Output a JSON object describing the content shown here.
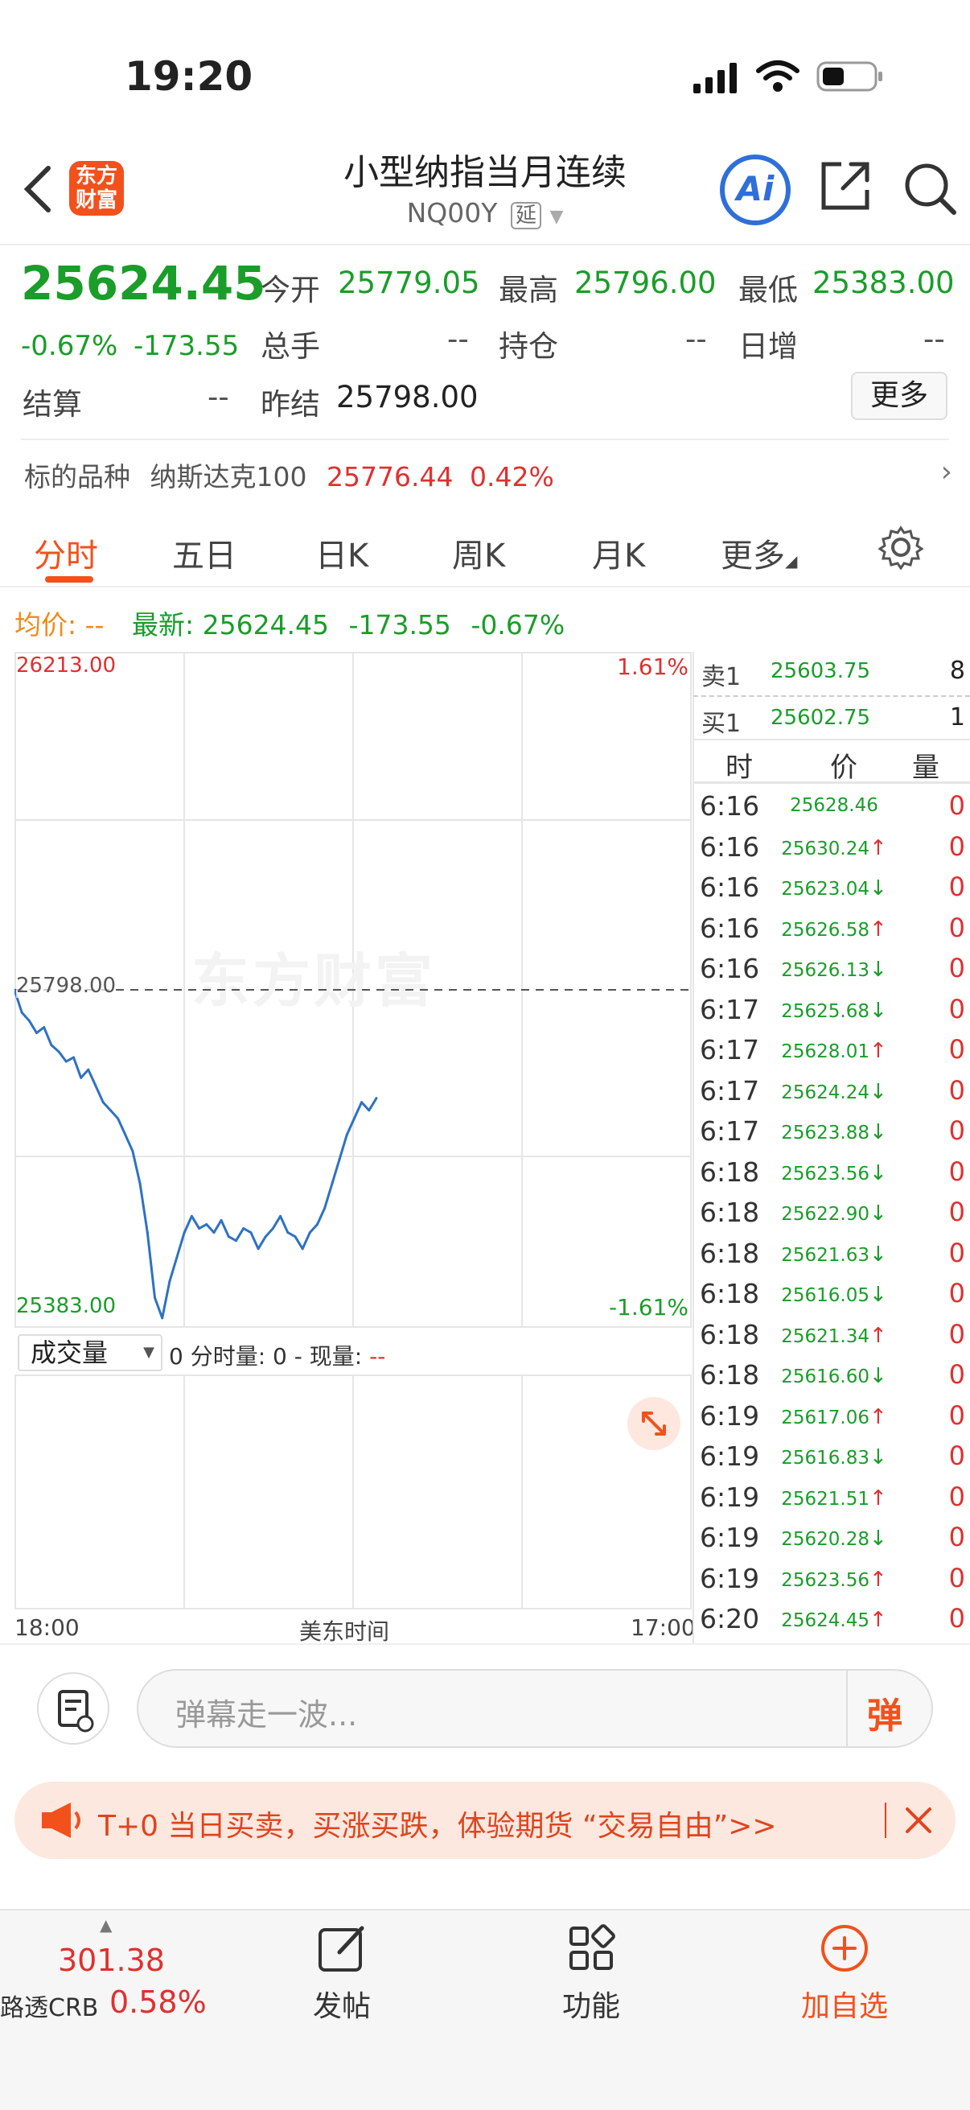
{
  "status": {
    "time": "19:20"
  },
  "header": {
    "logo_text": "东方\n财富",
    "title": "小型纳指当月连续",
    "code": "NQ00Y",
    "delay_badge": "延",
    "ai_label": "Ai"
  },
  "quote": {
    "last": "25624.45",
    "change_pct": "-0.67%",
    "change": "-173.55",
    "open_label": "今开",
    "open": "25779.05",
    "high_label": "最高",
    "high": "25796.00",
    "low_label": "最低",
    "low": "25383.00",
    "volume_label": "总手",
    "volume": "--",
    "oi_label": "持仓",
    "oi": "--",
    "daily_inc_label": "日增",
    "daily_inc": "--",
    "settle_label": "结算",
    "settle": "--",
    "prev_settle_label": "昨结",
    "prev_settle": "25798.00",
    "more_button": "更多"
  },
  "underlying": {
    "label": "标的品种",
    "name": "纳斯达克100",
    "price": "25776.44",
    "pct": "0.42%"
  },
  "tabs": [
    "分时",
    "五日",
    "日K",
    "周K",
    "月K",
    "更多"
  ],
  "avg_line": {
    "avg_label": "均价:",
    "avg_value": "--",
    "latest_label": "最新:",
    "latest_value": "25624.45",
    "change": "-173.55",
    "pct": "-0.67%"
  },
  "chart_labels": {
    "top_price": "26213.00",
    "top_pct": "1.61%",
    "ref_price": "25798.00",
    "bottom_price": "25383.00",
    "bottom_pct": "-1.61%",
    "watermark": "东方财富",
    "x_start": "18:00",
    "x_mid": "美东时间",
    "x_end": "17:00"
  },
  "volume_panel": {
    "selector": "成交量",
    "info_prefix": "0 分时量: 0 - 现量:",
    "info_value": "--"
  },
  "chart_data": {
    "type": "line",
    "title": "",
    "xlabel": "美东时间",
    "ylabel": "",
    "ylim": [
      25383.0,
      26213.0
    ],
    "reference": 25798.0,
    "x_range": [
      "18:00",
      "17:00"
    ],
    "series": [
      {
        "values": [
          25798,
          25770,
          25760,
          25745,
          25752,
          25730,
          25722,
          25710,
          25715,
          25690,
          25700,
          25680,
          25660,
          25650,
          25640,
          25620,
          25600,
          25560,
          25500,
          25420,
          25395,
          25440,
          25470,
          25500,
          25520,
          25505,
          25510,
          25500,
          25515,
          25495,
          25490,
          25505,
          25500,
          25480,
          25495,
          25505,
          25520,
          25500,
          25495,
          25480,
          25500,
          25510,
          25530,
          25560,
          25590,
          25620,
          25640,
          25660,
          25650,
          25665
        ]
      }
    ],
    "color": "#2d72c4"
  },
  "orderbook": {
    "sell_label": "卖1",
    "sell_price": "25603.75",
    "sell_qty": "8",
    "buy_label": "买1",
    "buy_price": "25602.75",
    "buy_qty": "1",
    "col_time": "时",
    "col_price": "价",
    "col_qty": "量"
  },
  "trades": [
    {
      "time": "6:16",
      "price": "25628.46",
      "dir": "",
      "qty": "0"
    },
    {
      "time": "6:16",
      "price": "25630.24",
      "dir": "up",
      "qty": "0"
    },
    {
      "time": "6:16",
      "price": "25623.04",
      "dir": "down",
      "qty": "0"
    },
    {
      "time": "6:16",
      "price": "25626.58",
      "dir": "up",
      "qty": "0"
    },
    {
      "time": "6:16",
      "price": "25626.13",
      "dir": "down",
      "qty": "0"
    },
    {
      "time": "6:17",
      "price": "25625.68",
      "dir": "down",
      "qty": "0"
    },
    {
      "time": "6:17",
      "price": "25628.01",
      "dir": "up",
      "qty": "0"
    },
    {
      "time": "6:17",
      "price": "25624.24",
      "dir": "down",
      "qty": "0"
    },
    {
      "time": "6:17",
      "price": "25623.88",
      "dir": "down",
      "qty": "0"
    },
    {
      "time": "6:18",
      "price": "25623.56",
      "dir": "down",
      "qty": "0"
    },
    {
      "time": "6:18",
      "price": "25622.90",
      "dir": "down",
      "qty": "0"
    },
    {
      "time": "6:18",
      "price": "25621.63",
      "dir": "down",
      "qty": "0"
    },
    {
      "time": "6:18",
      "price": "25616.05",
      "dir": "down",
      "qty": "0"
    },
    {
      "time": "6:18",
      "price": "25621.34",
      "dir": "up",
      "qty": "0"
    },
    {
      "time": "6:18",
      "price": "25616.60",
      "dir": "down",
      "qty": "0"
    },
    {
      "time": "6:19",
      "price": "25617.06",
      "dir": "up",
      "qty": "0"
    },
    {
      "time": "6:19",
      "price": "25616.83",
      "dir": "down",
      "qty": "0"
    },
    {
      "time": "6:19",
      "price": "25621.51",
      "dir": "up",
      "qty": "0"
    },
    {
      "time": "6:19",
      "price": "25620.28",
      "dir": "down",
      "qty": "0"
    },
    {
      "time": "6:19",
      "price": "25623.56",
      "dir": "up",
      "qty": "0"
    },
    {
      "time": "6:20",
      "price": "25624.45",
      "dir": "up",
      "qty": "0"
    }
  ],
  "comment": {
    "placeholder": "弹幕走一波...",
    "danmu_icon": "弹"
  },
  "promo": {
    "text": "T+0 当日买卖，买涨买跌，体验期货 “交易自由”>>"
  },
  "bottom_nav": {
    "index_value": "301.38",
    "index_name": "路透CRB",
    "index_pct": "0.58%",
    "post": "发帖",
    "functions": "功能",
    "add_watch": "加自选"
  },
  "colors": {
    "up": "#e0302f",
    "down": "#1a9d29",
    "accent": "#f2511c",
    "line": "#2d72c4"
  }
}
